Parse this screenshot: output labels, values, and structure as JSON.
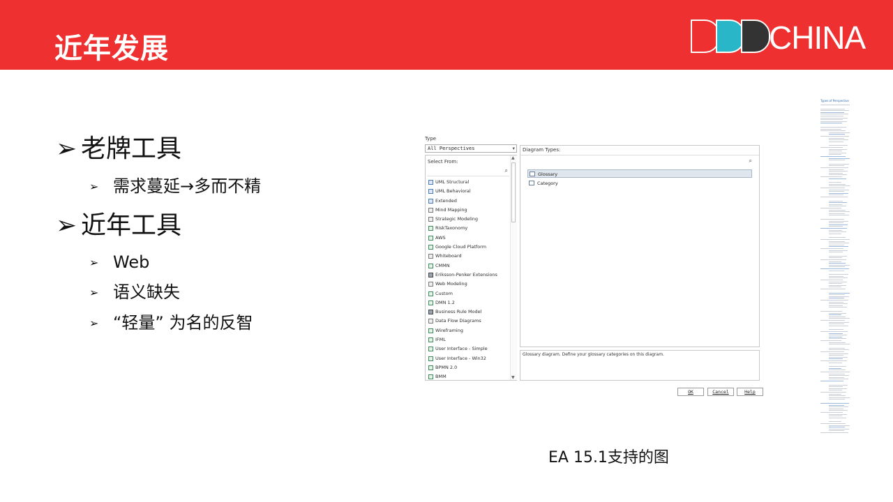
{
  "slide": {
    "title": "近年发展",
    "logo_text": "CHINA",
    "logo_letters": "DDD",
    "colors": {
      "header": "#ef3030",
      "logo_teal": "#29b6c8",
      "logo_dark": "#333333"
    }
  },
  "bullets": {
    "arrow": "➢",
    "sub_arrow": "➢",
    "item1": "老牌工具",
    "item1_sub1": "需求蔓延→多而不精",
    "item2": "近年工具",
    "item2_sub1": "Web",
    "item2_sub2": "语义缺失",
    "item2_sub3": "“轻量” 为名的反智"
  },
  "dialog": {
    "type_label": "Type",
    "perspective_value": "All Perspectives",
    "select_from_label": "Select From:",
    "diagram_types_label": "Diagram Types:",
    "search_icon": "⌕",
    "list_items": [
      "UML Structural",
      "UML Behavioral",
      "Extended",
      "Mind Mapping",
      "Strategic Modeling",
      "RiskTaxonomy",
      "AWS",
      "Google Cloud Platform",
      "Whiteboard",
      "CMMN",
      "Eriksson-Penker Extensions",
      "Web Modeling",
      "Custom",
      "DMN 1.2",
      "Business Rule Model",
      "Data Flow Diagrams",
      "Wireframing",
      "IFML",
      "User Interface - Simple",
      "User Interface - Win32",
      "BPMN 2.0",
      "BMM"
    ],
    "diagram_types": [
      "Glossary",
      "Category"
    ],
    "description": "Glossary diagram. Define your glossary categories on this diagram.",
    "buttons": {
      "ok": "OK",
      "cancel": "Cancel",
      "help": "Help"
    }
  },
  "thumbnail": {
    "title": "Types of Perspective"
  },
  "caption": "EA 15.1支持的图"
}
